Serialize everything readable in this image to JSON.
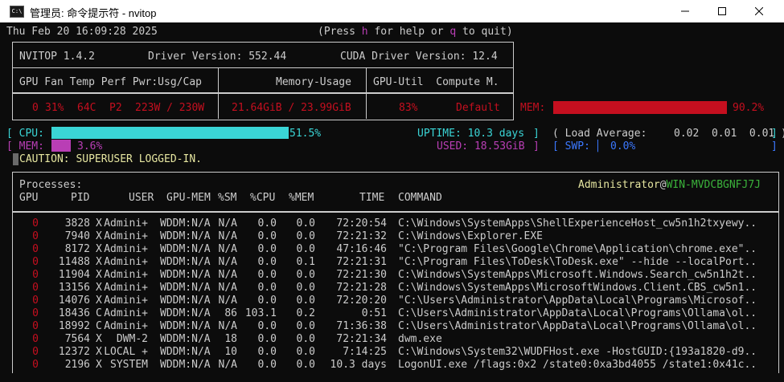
{
  "window": {
    "title": "管理员: 命令提示符 - nvitop",
    "icon_text": "C:\\",
    "minimize": "minimize-icon",
    "maximize": "maximize-icon",
    "close": "close-icon"
  },
  "header": {
    "datetime": "Thu Feb 20 16:09:28 2025",
    "help_open": "(Press ",
    "help_key_h": "h",
    "help_mid": " for help or ",
    "help_key_q": "q",
    "help_end": " to quit)"
  },
  "info": {
    "app": "NVITOP 1.4.2",
    "driver": "Driver Version: 552.44",
    "cuda": "CUDA Driver Version: 12.4",
    "col1": "GPU Fan Temp Perf Pwr:Usg/Cap",
    "col2": "Memory-Usage",
    "col3": "GPU-Util  Compute M."
  },
  "gpu": {
    "index": "0",
    "fan": "31%",
    "temp": "64C",
    "perf": "P2",
    "power": "223W / 230W",
    "memory": "21.64GiB / 23.99GiB",
    "util": "83%",
    "compute_mode": "Default",
    "mem_label": "MEM:",
    "mem_percent_text": "90.2%",
    "mem_fraction": 0.902,
    "colors": {
      "alert": "#c50f1f"
    }
  },
  "host": {
    "cpu_label": "CPU:",
    "cpu_percent_text": "51.5%",
    "cpu_fraction": 0.515,
    "uptime": "UPTIME: 10.3 days",
    "load_label": "( Load Average:",
    "load_values": "0.02  0.01  0.01 )",
    "mem_label": "MEM:",
    "mem_percent_text": "3.6%",
    "mem_fraction": 0.036,
    "used": "USED: 18.53GiB",
    "swp_label": "SWP:",
    "swp_percent_text": "0.0%",
    "caution": "CAUTION: SUPERUSER LOGGED-IN.",
    "colors": {
      "cpu": "#3ad5d6",
      "mem": "#b93eb5",
      "swp": "#3b78ff"
    }
  },
  "processes": {
    "title": "Processes:",
    "user": "Administrator",
    "at": "@",
    "host": "WIN-MVDCBGNFJ7J",
    "columns": [
      "GPU",
      "PID",
      "USER",
      "GPU-MEM",
      "%SM",
      "%CPU",
      "%MEM",
      "TIME",
      "COMMAND"
    ],
    "rows": [
      {
        "gpu": "0",
        "pid": "3828",
        "type": "X",
        "user": "Admini+",
        "gpumem": "WDDM:N/A",
        "sm": "N/A",
        "cpu": "0.0",
        "mem": "0.0",
        "time": "72:20:54",
        "cmd": "C:\\Windows\\SystemApps\\ShellExperienceHost_cw5n1h2txyewy.."
      },
      {
        "gpu": "0",
        "pid": "7940",
        "type": "X",
        "user": "Admini+",
        "gpumem": "WDDM:N/A",
        "sm": "N/A",
        "cpu": "0.0",
        "mem": "0.0",
        "time": "72:21:32",
        "cmd": "C:\\Windows\\Explorer.EXE"
      },
      {
        "gpu": "0",
        "pid": "8172",
        "type": "X",
        "user": "Admini+",
        "gpumem": "WDDM:N/A",
        "sm": "N/A",
        "cpu": "0.0",
        "mem": "0.0",
        "time": "47:16:46",
        "cmd": "\"C:\\Program Files\\Google\\Chrome\\Application\\chrome.exe\".."
      },
      {
        "gpu": "0",
        "pid": "11488",
        "type": "X",
        "user": "Admini+",
        "gpumem": "WDDM:N/A",
        "sm": "N/A",
        "cpu": "0.0",
        "mem": "0.1",
        "time": "72:21:31",
        "cmd": "\"C:\\Program Files\\ToDesk\\ToDesk.exe\" --hide --localPort.."
      },
      {
        "gpu": "0",
        "pid": "11904",
        "type": "X",
        "user": "Admini+",
        "gpumem": "WDDM:N/A",
        "sm": "N/A",
        "cpu": "0.0",
        "mem": "0.0",
        "time": "72:21:30",
        "cmd": "C:\\Windows\\SystemApps\\Microsoft.Windows.Search_cw5n1h2t.."
      },
      {
        "gpu": "0",
        "pid": "13156",
        "type": "X",
        "user": "Admini+",
        "gpumem": "WDDM:N/A",
        "sm": "N/A",
        "cpu": "0.0",
        "mem": "0.0",
        "time": "72:21:28",
        "cmd": "C:\\Windows\\SystemApps\\MicrosoftWindows.Client.CBS_cw5n1.."
      },
      {
        "gpu": "0",
        "pid": "14076",
        "type": "X",
        "user": "Admini+",
        "gpumem": "WDDM:N/A",
        "sm": "N/A",
        "cpu": "0.0",
        "mem": "0.0",
        "time": "72:20:20",
        "cmd": "\"C:\\Users\\Administrator\\AppData\\Local\\Programs\\Microsof.."
      },
      {
        "gpu": "0",
        "pid": "18436",
        "type": "C",
        "user": "Admini+",
        "gpumem": "WDDM:N/A",
        "sm": "86",
        "cpu": "103.1",
        "mem": "0.2",
        "time": "0:51",
        "cmd": "C:\\Users\\Administrator\\AppData\\Local\\Programs\\Ollama\\ol.."
      },
      {
        "gpu": "0",
        "pid": "18992",
        "type": "C",
        "user": "Admini+",
        "gpumem": "WDDM:N/A",
        "sm": "N/A",
        "cpu": "0.0",
        "mem": "0.0",
        "time": "71:36:38",
        "cmd": "C:\\Users\\Administrator\\AppData\\Local\\Programs\\Ollama\\ol.."
      },
      {
        "gpu": "0",
        "pid": "7564",
        "type": "X",
        "user": "DWM-2",
        "gpumem": "WDDM:N/A",
        "sm": "18",
        "cpu": "0.0",
        "mem": "0.0",
        "time": "72:21:34",
        "cmd": "dwm.exe"
      },
      {
        "gpu": "0",
        "pid": "12372",
        "type": "X",
        "user": "LOCAL +",
        "gpumem": "WDDM:N/A",
        "sm": "10",
        "cpu": "0.0",
        "mem": "0.0",
        "time": "7:14:25",
        "cmd": "C:\\Windows\\System32\\WUDFHost.exe -HostGUID:{193a1820-d9.."
      },
      {
        "gpu": "0",
        "pid": "2196",
        "type": "X",
        "user": "SYSTEM",
        "gpumem": "WDDM:N/A",
        "sm": "N/A",
        "cpu": "0.0",
        "mem": "0.0",
        "time": "10.3 days",
        "cmd": "LogonUI.exe /flags:0x2 /state0:0xa3bd4055 /state1:0x41c.."
      }
    ]
  }
}
